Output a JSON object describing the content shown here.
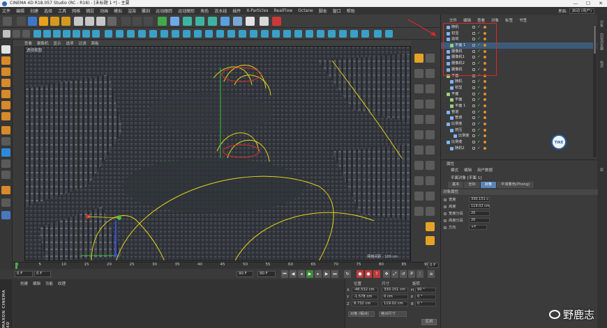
{
  "window": {
    "title": "CINEMA 4D R18.057 Studio (RC - R18) - [未标题 1 *] - 主要",
    "controls": [
      "—",
      "☐",
      "✕"
    ]
  },
  "menubar": {
    "items": [
      "文件",
      "编辑",
      "创建",
      "选择",
      "工具",
      "网格",
      "捕捉",
      "动画",
      "模拟",
      "渲染",
      "雕刻",
      "运动跟踪",
      "运动图形",
      "角色",
      "流水线",
      "插件",
      "X-Particles",
      "RealFlow",
      "Octane",
      "脚本",
      "窗口",
      "帮助"
    ],
    "layout_label": "界面:",
    "layout_value": "启动 (用户)"
  },
  "viewport": {
    "menu": [
      "查看",
      "摄像机",
      "显示",
      "选项",
      "过滤",
      "面板"
    ],
    "name": "透视视图",
    "grid_spacing": "网格间距 : 100 cm"
  },
  "timeline": {
    "ticks": [
      "0",
      "5",
      "10",
      "15",
      "20",
      "25",
      "30",
      "35",
      "40",
      "45",
      "50",
      "55",
      "60",
      "65",
      "70",
      "75",
      "80",
      "85",
      "90"
    ],
    "current_frame": "0 F",
    "start_field": "0 F",
    "range_start": "0 F",
    "range_end": "90 F",
    "end_field": "90 F"
  },
  "material_panel": {
    "menu": [
      "创建",
      "编辑",
      "功能",
      "纹理"
    ],
    "brand": "MAXON CINEMA 4D"
  },
  "coordinates": {
    "headers": [
      "位置",
      "尺寸",
      "旋转"
    ],
    "rows": [
      {
        "axis": "X",
        "pos": "-48.532 cm",
        "size": "330.151 cm",
        "rot_axis": "H",
        "rot": "90 °"
      },
      {
        "axis": "Y",
        "pos": "-1.578 cm",
        "size": "0 cm",
        "rot_axis": "P",
        "rot": "0 °"
      },
      {
        "axis": "Z",
        "pos": "8.732 cm",
        "size": "119.02 cm",
        "rot_axis": "B",
        "rot": "0 °"
      }
    ],
    "mode_dropdown": "对象 (相对)",
    "size_dropdown": "绝对尺寸",
    "apply": "应用"
  },
  "object_manager": {
    "tabs": [
      "文件",
      "编辑",
      "查看",
      "对象",
      "标签",
      "书签"
    ],
    "objects": [
      {
        "name": "随机",
        "indent": 0,
        "color": "#7db5ff"
      },
      {
        "name": "初显",
        "indent": 0,
        "color": "#7db5ff"
      },
      {
        "name": "运动",
        "indent": 0,
        "color": "#7db5ff"
      },
      {
        "name": "平面 1",
        "indent": 1,
        "color": "#9ad07a"
      },
      {
        "name": "摄像机",
        "indent": 0,
        "color": "#7db5ff"
      },
      {
        "name": "摄像机1",
        "indent": 0,
        "color": "#7db5ff"
      },
      {
        "name": "摄像机2",
        "indent": 0,
        "color": "#7db5ff"
      },
      {
        "name": "摄像机",
        "indent": 0,
        "color": "#7db5ff"
      },
      {
        "name": "平面",
        "indent": 0,
        "color": "#9ad07a"
      },
      {
        "name": "随机",
        "indent": 1,
        "color": "#7db5ff"
      },
      {
        "name": "初显",
        "indent": 1,
        "color": "#7db5ff"
      },
      {
        "name": "平面",
        "indent": 0,
        "color": "#9ad07a"
      },
      {
        "name": "平面",
        "indent": 1,
        "color": "#9ad07a"
      },
      {
        "name": "平面 1",
        "indent": 1,
        "color": "#9ad07a"
      },
      {
        "name": "管道",
        "indent": 0,
        "color": "#7db5ff"
      },
      {
        "name": "管道",
        "indent": 1,
        "color": "#7db5ff"
      },
      {
        "name": "比例变",
        "indent": 0,
        "color": "#7db5ff"
      },
      {
        "name": "挤压",
        "indent": 1,
        "color": "#7db5ff"
      },
      {
        "name": "比例变",
        "indent": 2,
        "color": "#7db5ff"
      },
      {
        "name": "比例变",
        "indent": 0,
        "color": "#7db5ff"
      },
      {
        "name": "随机2",
        "indent": 1,
        "color": "#7db5ff"
      }
    ]
  },
  "attributes": {
    "title": "属性",
    "menu": [
      "模式",
      "编辑",
      "用户数据"
    ],
    "object_name": "平面对象 [平面 1]",
    "tabs": [
      "基本",
      "坐标",
      "对象",
      "平滑着色(Phong)"
    ],
    "active_tab": "对象",
    "section": "对象属性",
    "props": [
      {
        "label": "宽度",
        "value": "330.151 c"
      },
      {
        "label": "高度",
        "value": "119.02 cm"
      },
      {
        "label": "宽度分段",
        "value": "20"
      },
      {
        "label": "高度分段",
        "value": "20"
      },
      {
        "label": "方向",
        "value": "+Y"
      }
    ]
  },
  "right_tabs": [
    "对象",
    "内容浏览器",
    "构造",
    "层"
  ],
  "badge": "TIKE",
  "watermark": "野鹿志",
  "colors": {
    "accent": "#5884b8",
    "highlight_box": "#e0262a",
    "spline": "#e6d21e"
  }
}
